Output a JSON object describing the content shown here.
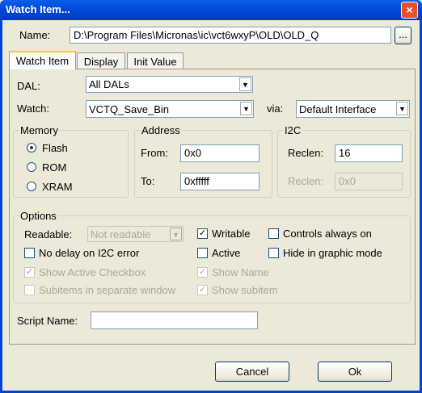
{
  "window": {
    "title": "Watch Item...",
    "close_icon": "×"
  },
  "name": {
    "label": "Name:",
    "value": "D:\\Program Files\\Micronas\\ic\\vct6wxyP\\OLD\\OLD_Q",
    "browse_label": "..."
  },
  "tabs": [
    {
      "label": "Watch Item",
      "active": true
    },
    {
      "label": "Display",
      "active": false
    },
    {
      "label": "Init Value",
      "active": false
    }
  ],
  "dal": {
    "label": "DAL:",
    "value": "All DALs"
  },
  "watch": {
    "label": "Watch:",
    "value": "VCTQ_Save_Bin",
    "via_label": "via:",
    "via_value": "Default Interface"
  },
  "memory": {
    "title": "Memory",
    "options": [
      "Flash",
      "ROM",
      "XRAM"
    ],
    "selected": "Flash"
  },
  "address": {
    "title": "Address",
    "from_label": "From:",
    "from_value": "0x0",
    "to_label": "To:",
    "to_value": "0xfffff"
  },
  "i2c": {
    "title": "I2C",
    "reclen_label": "Reclen:",
    "reclen_value": "16",
    "reclen2_label": "Reclen:",
    "reclen2_value": "0x0"
  },
  "options": {
    "title": "Options",
    "readable_label": "Readable:",
    "readable_value": "Not readable",
    "writable": {
      "label": "Writable",
      "checked": true
    },
    "controls_always_on": {
      "label": "Controls always on",
      "checked": false
    },
    "no_delay": {
      "label": "No delay on I2C error",
      "checked": false
    },
    "active": {
      "label": "Active",
      "checked": false
    },
    "hide_graphic": {
      "label": "Hide in graphic mode",
      "checked": false
    },
    "show_active_checkbox": {
      "label": "Show Active Checkbox",
      "checked": true
    },
    "show_name": {
      "label": "Show Name",
      "checked": true
    },
    "subitems_separate": {
      "label": "Subitems in separate window",
      "checked": false
    },
    "show_subitem": {
      "label": "Show subitem",
      "checked": true
    }
  },
  "script": {
    "label": "Script Name:",
    "value": ""
  },
  "buttons": {
    "cancel": "Cancel",
    "ok": "Ok"
  },
  "icons": {
    "check": "✓",
    "dropdown": "▼"
  }
}
